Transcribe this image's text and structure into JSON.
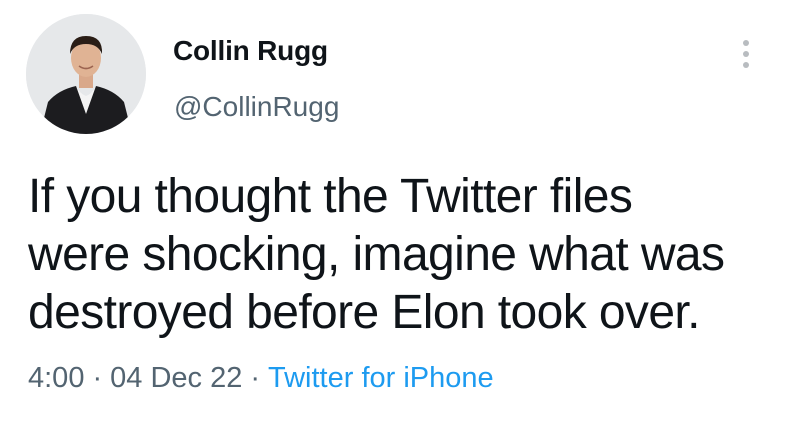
{
  "author": {
    "display_name": "Collin Rugg",
    "handle": "@CollinRugg"
  },
  "tweet": {
    "text_lines": [
      "If you thought the Twitter files",
      "were shocking, imagine what was",
      "destroyed before Elon took over."
    ]
  },
  "meta": {
    "time": "4:00",
    "separator": "·",
    "date": "04 Dec 22",
    "source": "Twitter for iPhone"
  },
  "icons": {
    "more": "more-vertical-icon",
    "avatar": "profile-photo"
  },
  "colors": {
    "text_primary": "#0f1419",
    "text_secondary": "#536471",
    "link": "#1d9bf0",
    "background": "#ffffff"
  }
}
